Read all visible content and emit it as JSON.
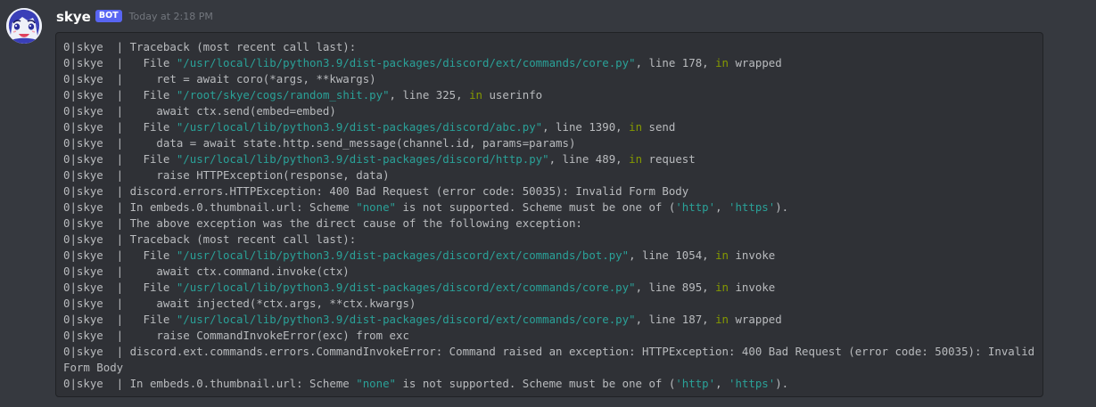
{
  "message": {
    "author": "skye",
    "bot_badge": "BOT",
    "timestamp": "Today at 2:18 PM",
    "avatar_icon": "anime-girl-avatar-icon",
    "code_lines": [
      [
        {
          "t": "0|skye  | Traceback (most recent call last):"
        }
      ],
      [
        {
          "t": "0|skye  |   File "
        },
        {
          "t": "\"/usr/local/lib/python3.9/dist-packages/discord/ext/commands/core.py\"",
          "c": "str"
        },
        {
          "t": ", line 178, "
        },
        {
          "t": "in",
          "c": "kw"
        },
        {
          "t": " wrapped"
        }
      ],
      [
        {
          "t": "0|skye  |     ret = await coro(*args, **kwargs)"
        }
      ],
      [
        {
          "t": "0|skye  |   File "
        },
        {
          "t": "\"/root/skye/cogs/random_shit.py\"",
          "c": "str"
        },
        {
          "t": ", line 325, "
        },
        {
          "t": "in",
          "c": "kw"
        },
        {
          "t": " userinfo"
        }
      ],
      [
        {
          "t": "0|skye  |     await ctx.send(embed=embed)"
        }
      ],
      [
        {
          "t": "0|skye  |   File "
        },
        {
          "t": "\"/usr/local/lib/python3.9/dist-packages/discord/abc.py\"",
          "c": "str"
        },
        {
          "t": ", line 1390, "
        },
        {
          "t": "in",
          "c": "kw"
        },
        {
          "t": " send"
        }
      ],
      [
        {
          "t": "0|skye  |     data = await state.http.send_message(channel.id, params=params)"
        }
      ],
      [
        {
          "t": "0|skye  |   File "
        },
        {
          "t": "\"/usr/local/lib/python3.9/dist-packages/discord/http.py\"",
          "c": "str"
        },
        {
          "t": ", line 489, "
        },
        {
          "t": "in",
          "c": "kw"
        },
        {
          "t": " request"
        }
      ],
      [
        {
          "t": "0|skye  |     raise HTTPException(response, data)"
        }
      ],
      [
        {
          "t": "0|skye  | discord.errors.HTTPException: 400 Bad Request (error code: 50035): Invalid Form Body"
        }
      ],
      [
        {
          "t": "0|skye  | In embeds.0.thumbnail.url: Scheme "
        },
        {
          "t": "\"none\"",
          "c": "str"
        },
        {
          "t": " is not supported. Scheme must be one of ("
        },
        {
          "t": "'http'",
          "c": "str"
        },
        {
          "t": ", "
        },
        {
          "t": "'https'",
          "c": "str"
        },
        {
          "t": ")."
        }
      ],
      [
        {
          "t": "0|skye  | The above exception was the direct cause of the following exception:"
        }
      ],
      [
        {
          "t": "0|skye  | Traceback (most recent call last):"
        }
      ],
      [
        {
          "t": "0|skye  |   File "
        },
        {
          "t": "\"/usr/local/lib/python3.9/dist-packages/discord/ext/commands/bot.py\"",
          "c": "str"
        },
        {
          "t": ", line 1054, "
        },
        {
          "t": "in",
          "c": "kw"
        },
        {
          "t": " invoke"
        }
      ],
      [
        {
          "t": "0|skye  |     await ctx.command.invoke(ctx)"
        }
      ],
      [
        {
          "t": "0|skye  |   File "
        },
        {
          "t": "\"/usr/local/lib/python3.9/dist-packages/discord/ext/commands/core.py\"",
          "c": "str"
        },
        {
          "t": ", line 895, "
        },
        {
          "t": "in",
          "c": "kw"
        },
        {
          "t": " invoke"
        }
      ],
      [
        {
          "t": "0|skye  |     await injected(*ctx.args, **ctx.kwargs)"
        }
      ],
      [
        {
          "t": "0|skye  |   File "
        },
        {
          "t": "\"/usr/local/lib/python3.9/dist-packages/discord/ext/commands/core.py\"",
          "c": "str"
        },
        {
          "t": ", line 187, "
        },
        {
          "t": "in",
          "c": "kw"
        },
        {
          "t": " wrapped"
        }
      ],
      [
        {
          "t": "0|skye  |     raise CommandInvokeError(exc) from exc"
        }
      ],
      [
        {
          "t": "0|skye  | discord.ext.commands.errors.CommandInvokeError: Command raised an exception: HTTPException: 400 Bad Request (error code: 50035): Invalid Form Body"
        }
      ],
      [
        {
          "t": "0|skye  | In embeds.0.thumbnail.url: Scheme "
        },
        {
          "t": "\"none\"",
          "c": "str"
        },
        {
          "t": " is not supported. Scheme must be one of ("
        },
        {
          "t": "'http'",
          "c": "str"
        },
        {
          "t": ", "
        },
        {
          "t": "'https'",
          "c": "str"
        },
        {
          "t": ")."
        }
      ]
    ]
  },
  "colors": {
    "background": "#36393f",
    "codeblock_bg": "#2f3136",
    "code_text": "#b9bbbe",
    "string": "#2aa198",
    "keyword": "#859900",
    "bot_badge": "#5865f2",
    "timestamp": "#72767d"
  }
}
